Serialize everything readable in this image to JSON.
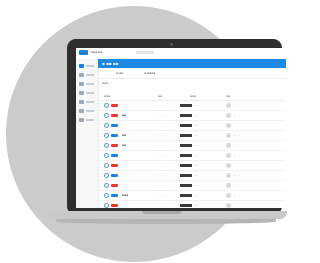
{
  "colors": {
    "accent": "#1e88e5",
    "badge_red": "#e53935",
    "badge_blue": "#1d7fe0",
    "background_disc": "#cbcbcb"
  },
  "topbar": {
    "label": "▪▪▪ ▪▪"
  },
  "header": {
    "title": "▪ ▪▪ ▪▪"
  },
  "tabs": [
    "▪ ▪▪",
    "▪ ▪▪▪▪"
  ],
  "filter": {
    "label": "▪▪▪"
  },
  "table": {
    "columns": [
      "▪▪▪",
      "▪▪",
      "▪▪▪",
      "▪▪"
    ],
    "rows": [
      {
        "badge": "red",
        "name": "",
        "mid": "- - -",
        "val": "- -",
        "tail": "-"
      },
      {
        "badge": "red",
        "name": "▪▪",
        "mid": "- - -",
        "val": "- -",
        "tail": "-"
      },
      {
        "badge": "blue",
        "name": "",
        "mid": "- - -",
        "val": "- -",
        "tail": "-"
      },
      {
        "badge": "blue",
        "name": "▪▪",
        "mid": "- - -",
        "val": "- -",
        "tail": "-"
      },
      {
        "badge": "red",
        "name": "▪▪",
        "mid": "- - -",
        "val": "- -",
        "tail": "-"
      },
      {
        "badge": "blue",
        "name": "",
        "mid": "- - -",
        "val": "- -",
        "tail": "-"
      },
      {
        "badge": "red",
        "name": "",
        "mid": "- - -",
        "val": "- -",
        "tail": "-"
      },
      {
        "badge": "blue",
        "name": "",
        "mid": "- - -",
        "val": "- -",
        "tail": "-"
      },
      {
        "badge": "red",
        "name": "",
        "mid": "- - -",
        "val": "- -",
        "tail": "-"
      },
      {
        "badge": "blue",
        "name": "▪▪▪",
        "mid": "- - -",
        "val": "- -",
        "tail": "-"
      },
      {
        "badge": "red",
        "name": "",
        "mid": "- - -",
        "val": "- -",
        "tail": "-"
      }
    ]
  },
  "sidebar": {
    "items": [
      {
        "icon": "home-icon",
        "active": true
      },
      {
        "icon": "grid-icon",
        "active": false
      },
      {
        "icon": "user-icon",
        "active": false
      },
      {
        "icon": "chart-icon",
        "active": false
      },
      {
        "icon": "gear-icon",
        "active": false
      },
      {
        "icon": "list-icon",
        "active": false
      },
      {
        "icon": "bell-icon",
        "active": false
      }
    ]
  }
}
